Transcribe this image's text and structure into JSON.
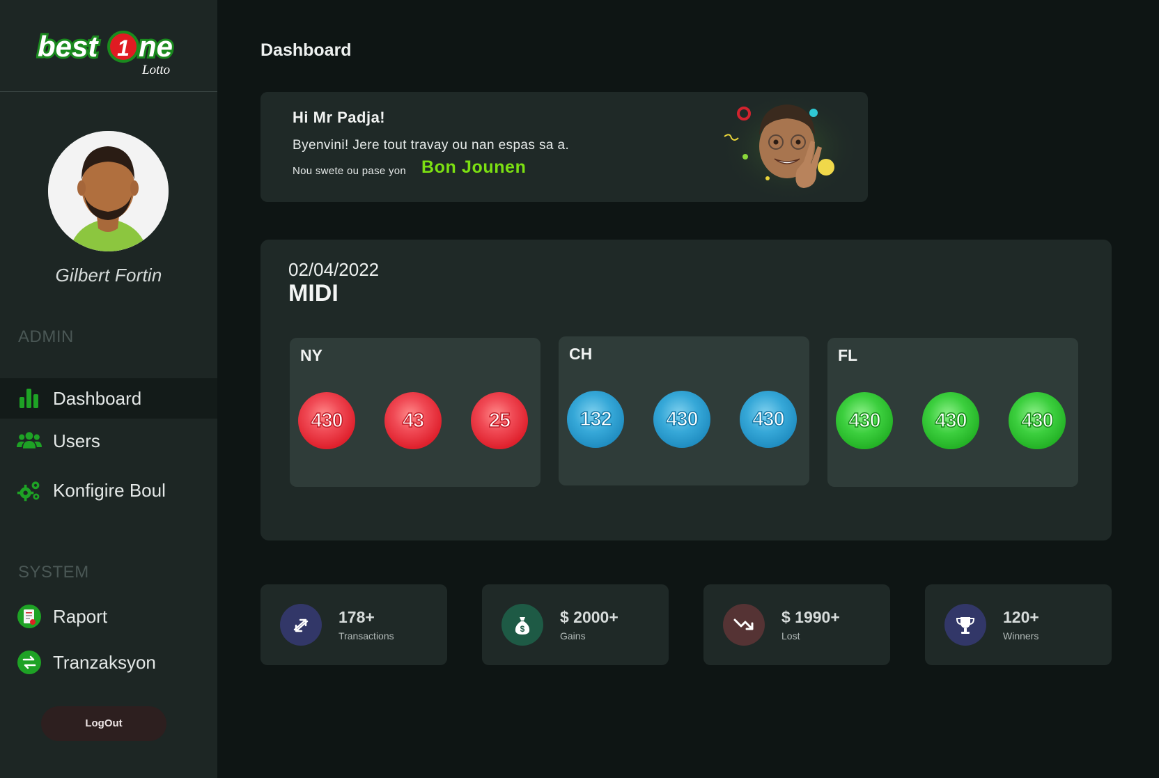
{
  "brand": {
    "logo_text_left": "best",
    "logo_digit": "1",
    "logo_text_right": "ne",
    "logo_sub": "Lotto"
  },
  "user": {
    "name": "Gilbert Fortin"
  },
  "sidebar": {
    "sections": [
      {
        "label": "ADMIN",
        "items": [
          {
            "label": "Dashboard",
            "icon": "bar-chart-icon",
            "active": true
          },
          {
            "label": "Users",
            "icon": "users-icon"
          },
          {
            "label": "Konfigire Boul",
            "icon": "gears-icon"
          }
        ]
      },
      {
        "label": "SYSTEM",
        "items": [
          {
            "label": "Raport",
            "icon": "report-icon"
          },
          {
            "label": "Tranzaksyon",
            "icon": "exchange-icon"
          }
        ]
      }
    ],
    "logout_label": "LogOut"
  },
  "header": {
    "title": "Dashboard"
  },
  "welcome": {
    "greeting": "Hi Mr Padja!",
    "message": "Byenvini! Jere tout travay ou nan espas sa a.",
    "wish_prefix": "Nou swete ou pase yon",
    "wish_highlight": "Bon Jounen"
  },
  "draw": {
    "date": "02/04/2022",
    "period": "MIDI",
    "states": [
      {
        "name": "NY",
        "color": "red",
        "balls": [
          "430",
          "43",
          "25"
        ]
      },
      {
        "name": "CH",
        "color": "blue",
        "balls": [
          "132",
          "430",
          "430"
        ]
      },
      {
        "name": "FL",
        "color": "green",
        "balls": [
          "430",
          "430",
          "430"
        ]
      }
    ]
  },
  "stats": [
    {
      "value": "178+",
      "label": "Transactions",
      "icon": "transactions-icon",
      "color": "#323768"
    },
    {
      "value": "$ 2000+",
      "label": "Gains",
      "icon": "money-bag-icon",
      "color": "#1e5a45"
    },
    {
      "value": "$ 1990+",
      "label": "Lost",
      "icon": "trend-down-icon",
      "color": "#553334"
    },
    {
      "value": "120+",
      "label": "Winners",
      "icon": "trophy-icon",
      "color": "#323768"
    }
  ],
  "colors": {
    "accent_green": "#22a024",
    "highlight": "#7ce012",
    "background": "#0e1514",
    "panel": "#1f2927"
  }
}
